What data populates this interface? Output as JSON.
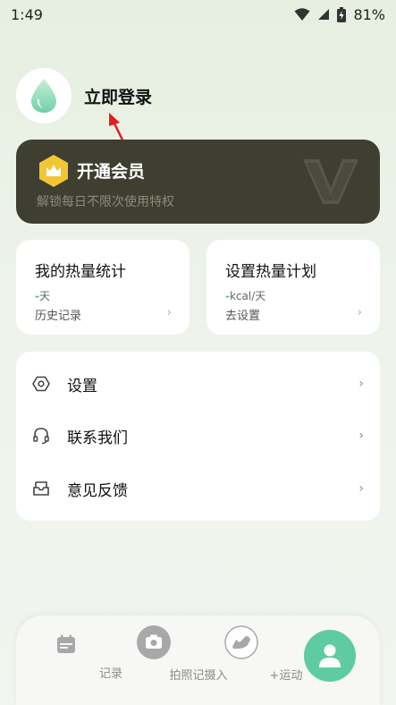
{
  "status": {
    "time": "1:49",
    "battery": "81%"
  },
  "profile": {
    "login_label": "立即登录"
  },
  "vip": {
    "title": "开通会员",
    "subtitle": "解锁每日不限次使用特权"
  },
  "stats": [
    {
      "title": "我的热量统计",
      "value_dash": "-",
      "value_unit": "天",
      "link": "历史记录"
    },
    {
      "title": "设置热量计划",
      "value_dash": "-",
      "value_unit": "kcal/天",
      "link": "去设置"
    }
  ],
  "menu": [
    {
      "label": "设置",
      "icon": "settings-hexagon-icon"
    },
    {
      "label": "联系我们",
      "icon": "headset-icon"
    },
    {
      "label": "意见反馈",
      "icon": "feedback-inbox-icon"
    }
  ],
  "tabs": [
    {
      "label": "记录",
      "icon": "calendar-icon"
    },
    {
      "label": "拍照记摄入",
      "icon": "camera-icon"
    },
    {
      "label": "+运动",
      "icon": "shoe-icon"
    },
    {
      "label": "",
      "icon": "user-icon"
    }
  ],
  "colors": {
    "accent": "#5fcba3",
    "vip_bg": "#3e3e31",
    "vip_badge": "#f2c535",
    "annotation": "#e02020"
  }
}
